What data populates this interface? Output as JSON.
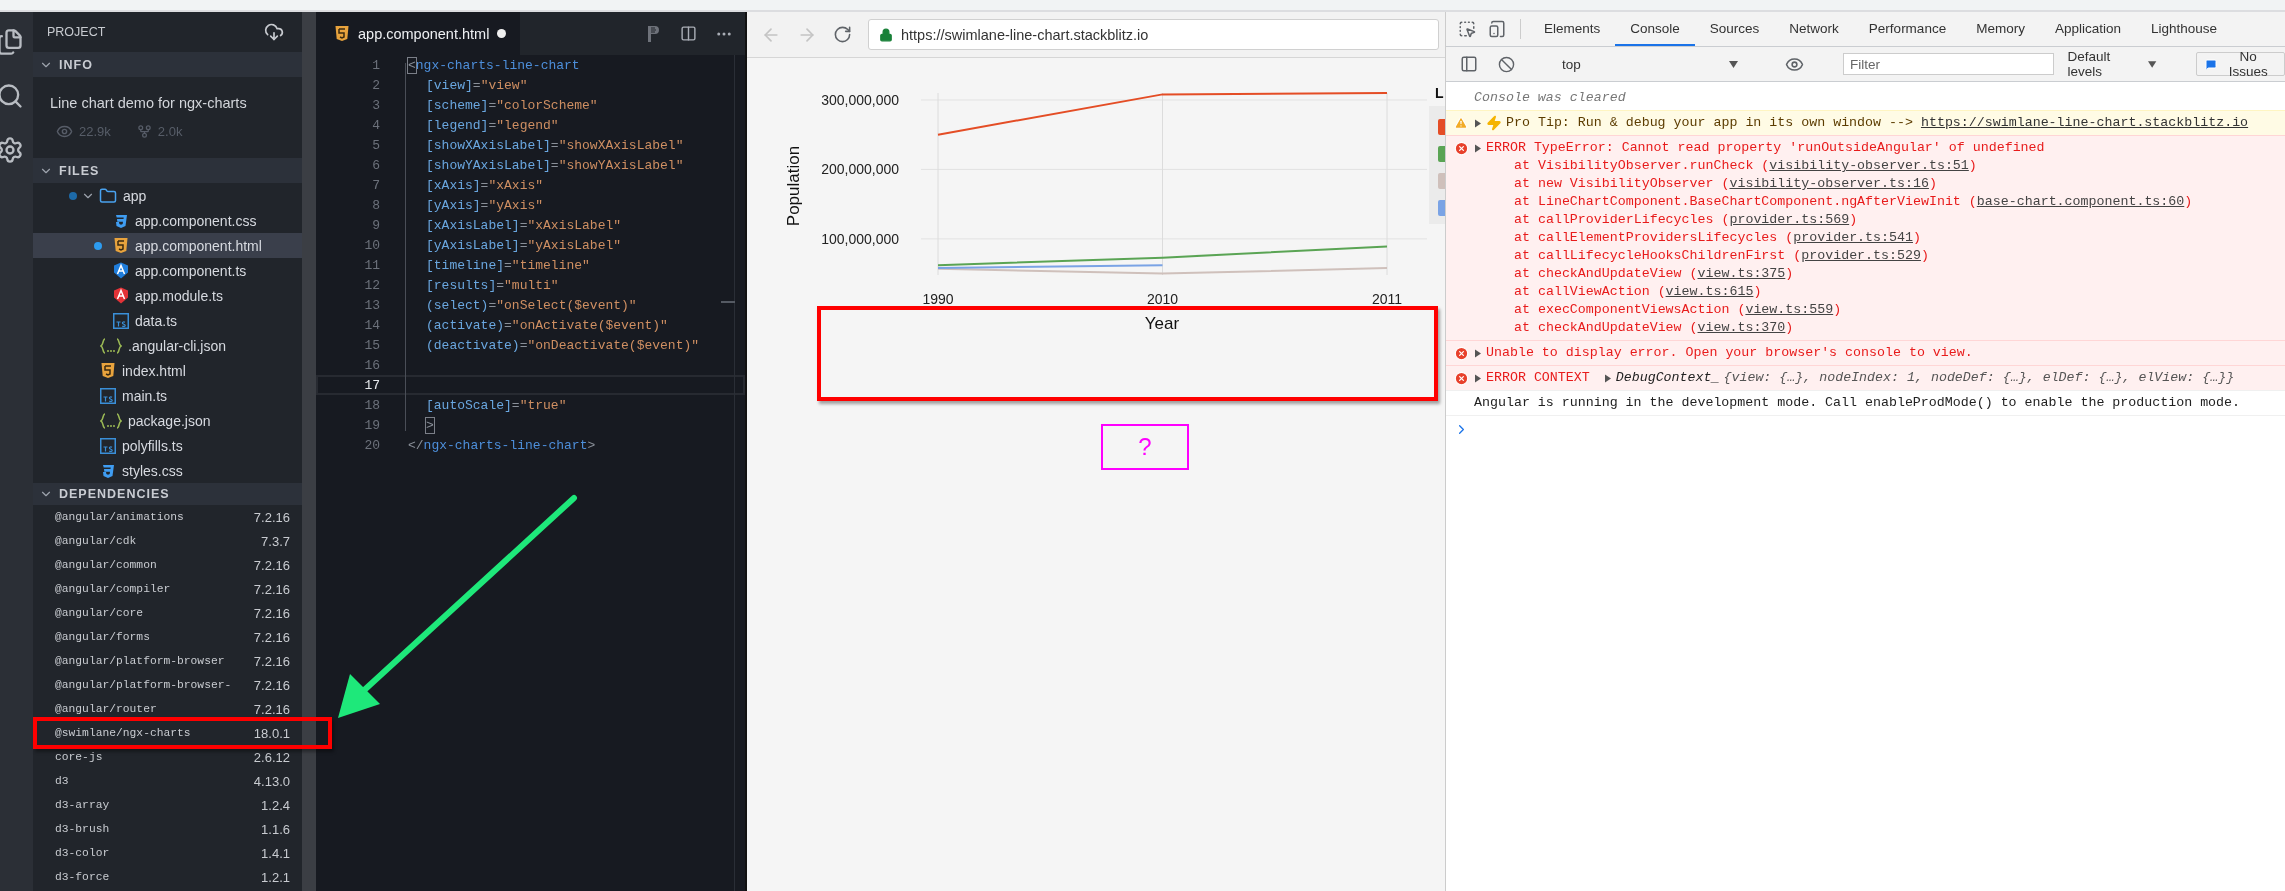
{
  "sidebar": {
    "title": "PROJECT",
    "info": {
      "title": "INFO",
      "expanded": true,
      "description": "Line chart demo for ngx-charts",
      "views": "22.9k",
      "forks": "2.0k"
    },
    "files": {
      "title": "FILES",
      "expanded": true,
      "tree": [
        {
          "name": "app",
          "kind": "folder",
          "expanded": true,
          "modified": true,
          "selected": false,
          "children": [
            {
              "name": "app.component.css",
              "kind": "css",
              "modified": false,
              "selected": false
            },
            {
              "name": "app.component.html",
              "kind": "html",
              "modified": true,
              "selected": true
            },
            {
              "name": "app.component.ts",
              "kind": "angular_component",
              "modified": false,
              "selected": false
            },
            {
              "name": "app.module.ts",
              "kind": "angular_module",
              "modified": false,
              "selected": false
            },
            {
              "name": "data.ts",
              "kind": "typescript",
              "modified": false,
              "selected": false
            }
          ]
        },
        {
          "name": ".angular-cli.json",
          "kind": "json",
          "modified": false,
          "selected": false
        },
        {
          "name": "index.html",
          "kind": "html",
          "modified": false,
          "selected": false
        },
        {
          "name": "main.ts",
          "kind": "typescript",
          "modified": false,
          "selected": false
        },
        {
          "name": "package.json",
          "kind": "json",
          "modified": false,
          "selected": false
        },
        {
          "name": "polyfills.ts",
          "kind": "typescript",
          "modified": false,
          "selected": false
        },
        {
          "name": "styles.css",
          "kind": "css",
          "modified": false,
          "selected": false
        }
      ]
    },
    "dependencies": {
      "title": "DEPENDENCIES",
      "expanded": true,
      "items": [
        {
          "name": "@angular/animations",
          "version": "7.2.16"
        },
        {
          "name": "@angular/cdk",
          "version": "7.3.7"
        },
        {
          "name": "@angular/common",
          "version": "7.2.16"
        },
        {
          "name": "@angular/compiler",
          "version": "7.2.16"
        },
        {
          "name": "@angular/core",
          "version": "7.2.16"
        },
        {
          "name": "@angular/forms",
          "version": "7.2.16"
        },
        {
          "name": "@angular/platform-browser",
          "version": "7.2.16"
        },
        {
          "name": "@angular/platform-browser-",
          "version": "7.2.16"
        },
        {
          "name": "@angular/router",
          "version": "7.2.16"
        },
        {
          "name": "@swimlane/ngx-charts",
          "version": "18.0.1"
        },
        {
          "name": "core-js",
          "version": "2.6.12"
        },
        {
          "name": "d3",
          "version": "4.13.0"
        },
        {
          "name": "d3-array",
          "version": "1.2.4"
        },
        {
          "name": "d3-brush",
          "version": "1.1.6"
        },
        {
          "name": "d3-color",
          "version": "1.4.1"
        },
        {
          "name": "d3-force",
          "version": "1.2.1"
        }
      ]
    }
  },
  "editor": {
    "tab": {
      "label": "app.component.html",
      "modified": true
    },
    "lines": [
      {
        "number": "1",
        "current": false,
        "parts": [
          {
            "kind": "match",
            "text": "<"
          },
          {
            "kind": "tag",
            "text": "ngx-charts-line-chart"
          }
        ]
      },
      {
        "number": "2",
        "current": false,
        "parts": [
          {
            "kind": "attr",
            "text": "[view]"
          },
          {
            "kind": "punct",
            "text": "="
          },
          {
            "kind": "value",
            "text": "\"view\""
          }
        ]
      },
      {
        "number": "3",
        "current": false,
        "parts": [
          {
            "kind": "attr",
            "text": "[scheme]"
          },
          {
            "kind": "punct",
            "text": "="
          },
          {
            "kind": "value",
            "text": "\"colorScheme\""
          }
        ]
      },
      {
        "number": "4",
        "current": false,
        "parts": [
          {
            "kind": "attr",
            "text": "[legend]"
          },
          {
            "kind": "punct",
            "text": "="
          },
          {
            "kind": "value",
            "text": "\"legend\""
          }
        ]
      },
      {
        "number": "5",
        "current": false,
        "parts": [
          {
            "kind": "attr",
            "text": "[showXAxisLabel]"
          },
          {
            "kind": "punct",
            "text": "="
          },
          {
            "kind": "value",
            "text": "\"showXAxisLabel\""
          }
        ]
      },
      {
        "number": "6",
        "current": false,
        "parts": [
          {
            "kind": "attr",
            "text": "[showYAxisLabel]"
          },
          {
            "kind": "punct",
            "text": "="
          },
          {
            "kind": "value",
            "text": "\"showYAxisLabel\""
          }
        ]
      },
      {
        "number": "7",
        "current": false,
        "parts": [
          {
            "kind": "attr",
            "text": "[xAxis]"
          },
          {
            "kind": "punct",
            "text": "="
          },
          {
            "kind": "value",
            "text": "\"xAxis\""
          }
        ]
      },
      {
        "number": "8",
        "current": false,
        "parts": [
          {
            "kind": "attr",
            "text": "[yAxis]"
          },
          {
            "kind": "punct",
            "text": "="
          },
          {
            "kind": "value",
            "text": "\"yAxis\""
          }
        ]
      },
      {
        "number": "9",
        "current": false,
        "parts": [
          {
            "kind": "attr",
            "text": "[xAxisLabel]"
          },
          {
            "kind": "punct",
            "text": "="
          },
          {
            "kind": "value",
            "text": "\"xAxisLabel\""
          }
        ]
      },
      {
        "number": "10",
        "current": false,
        "parts": [
          {
            "kind": "attr",
            "text": "[yAxisLabel]"
          },
          {
            "kind": "punct",
            "text": "="
          },
          {
            "kind": "value",
            "text": "\"yAxisLabel\""
          }
        ]
      },
      {
        "number": "11",
        "current": false,
        "parts": [
          {
            "kind": "attr",
            "text": "[timeline]"
          },
          {
            "kind": "punct",
            "text": "="
          },
          {
            "kind": "value",
            "text": "\"timeline\""
          }
        ]
      },
      {
        "number": "12",
        "current": false,
        "parts": [
          {
            "kind": "attr",
            "text": "[results]"
          },
          {
            "kind": "punct",
            "text": "="
          },
          {
            "kind": "value",
            "text": "\"multi\""
          }
        ]
      },
      {
        "number": "13",
        "current": false,
        "parts": [
          {
            "kind": "attr",
            "text": "(select)"
          },
          {
            "kind": "punct",
            "text": "="
          },
          {
            "kind": "value",
            "text": "\"onSelect($event)\""
          }
        ]
      },
      {
        "number": "14",
        "current": false,
        "parts": [
          {
            "kind": "attr",
            "text": "(activate)"
          },
          {
            "kind": "punct",
            "text": "="
          },
          {
            "kind": "value",
            "text": "\"onActivate($event)\""
          }
        ]
      },
      {
        "number": "15",
        "current": false,
        "parts": [
          {
            "kind": "attr",
            "text": "(deactivate)"
          },
          {
            "kind": "punct",
            "text": "="
          },
          {
            "kind": "value",
            "text": "\"onDeactivate($event)\""
          }
        ]
      },
      {
        "number": "16",
        "current": false
      },
      {
        "number": "17",
        "current": true
      },
      {
        "number": "18",
        "current": false,
        "parts": [
          {
            "kind": "attr",
            "text": "[autoScale]"
          },
          {
            "kind": "punct",
            "text": "="
          },
          {
            "kind": "value",
            "text": "\"true\""
          }
        ]
      },
      {
        "number": "19",
        "current": false,
        "parts": [
          {
            "kind": "match",
            "text": ">"
          }
        ]
      },
      {
        "number": "20",
        "current": false,
        "parts": [
          {
            "kind": "punct",
            "text": "</"
          },
          {
            "kind": "tag",
            "text": "ngx-charts-line-chart"
          },
          {
            "kind": "punct",
            "text": ">"
          }
        ]
      }
    ]
  },
  "preview": {
    "url": "https://swimlane-line-chart.stackblitz.io",
    "legend_title": "L",
    "chart_data": {
      "type": "line",
      "xlabel": "Year",
      "ylabel": "Population",
      "categories": [
        "1990",
        "2010",
        "2011"
      ],
      "series": [
        {
          "color": "#e44d25",
          "values": [
            250000000,
            308000000,
            310000000
          ]
        },
        {
          "color": "#5aa454",
          "values": [
            62000000,
            73000000,
            89000000
          ]
        },
        {
          "color": "#cfc0bb",
          "values": [
            57000000,
            50000000,
            58000000
          ]
        },
        {
          "color": "#7aa3e5",
          "values": [
            58000000,
            62000000,
            null
          ]
        }
      ],
      "ylim": [
        48000000,
        310000000
      ],
      "grid": true,
      "yticks": [
        {
          "value": 100000000,
          "label": "100,000,000"
        },
        {
          "value": 200000000,
          "label": "200,000,000"
        },
        {
          "value": 300000000,
          "label": "300,000,000"
        }
      ]
    }
  },
  "devtools": {
    "tabs": [
      {
        "label": "Elements",
        "selected": false
      },
      {
        "label": "Console",
        "selected": true
      },
      {
        "label": "Sources",
        "selected": false
      },
      {
        "label": "Network",
        "selected": false
      },
      {
        "label": "Performance",
        "selected": false
      },
      {
        "label": "Memory",
        "selected": false
      },
      {
        "label": "Application",
        "selected": false
      },
      {
        "label": "Lighthouse",
        "selected": false
      }
    ],
    "toolbar": {
      "context": "top",
      "filter_placeholder": "Filter",
      "levels": "Default levels",
      "issues": "No Issues"
    },
    "console": [
      {
        "kind": "info",
        "text": "Console was cleared"
      },
      {
        "kind": "warning",
        "text": "Pro Tip: Run & debug your app in its own window -->",
        "link": "https://swimlane-line-chart.stackblitz.io"
      },
      {
        "kind": "error",
        "text": "ERROR TypeError: Cannot read property 'runOutsideAngular' of undefined",
        "stack": [
          {
            "text": "at VisibilityObserver.runCheck (",
            "link": "visibility-observer.ts:51",
            "end": ")"
          },
          {
            "text": "at new VisibilityObserver (",
            "link": "visibility-observer.ts:16",
            "end": ")"
          },
          {
            "text": "at LineChartComponent.BaseChartComponent.ngAfterViewInit (",
            "link": "base-chart.component.ts:60",
            "end": ")"
          },
          {
            "text": "at callProviderLifecycles (",
            "link": "provider.ts:569",
            "end": ")"
          },
          {
            "text": "at callElementProvidersLifecycles (",
            "link": "provider.ts:541",
            "end": ")"
          },
          {
            "text": "at callLifecycleHooksChildrenFirst (",
            "link": "provider.ts:529",
            "end": ")"
          },
          {
            "text": "at checkAndUpdateView (",
            "link": "view.ts:375",
            "end": ")"
          },
          {
            "text": "at callViewAction (",
            "link": "view.ts:615",
            "end": ")"
          },
          {
            "text": "at execComponentViewsAction (",
            "link": "view.ts:559",
            "end": ")"
          },
          {
            "text": "at checkAndUpdateView (",
            "link": "view.ts:370",
            "end": ")"
          }
        ]
      },
      {
        "kind": "error",
        "text": "Unable to display error. Open your browser's console to view."
      },
      {
        "kind": "error_context",
        "label": "ERROR CONTEXT",
        "object": "DebugContext_",
        "preview": "{view: {…}, nodeIndex: 1, nodeDef: {…}, elDef: {…}, elView: {…}}"
      },
      {
        "kind": "log",
        "text": "Angular is running in the development mode. Call enableProdMode() to enable the production mode."
      }
    ]
  },
  "annotations": [
    {
      "kind": "box",
      "color": "#ff0000"
    },
    {
      "kind": "box",
      "color": "#ff0000"
    },
    {
      "kind": "label_box",
      "color": "#ff00ff",
      "text": "?"
    },
    {
      "kind": "arrow",
      "color": "#1ee87a"
    }
  ]
}
